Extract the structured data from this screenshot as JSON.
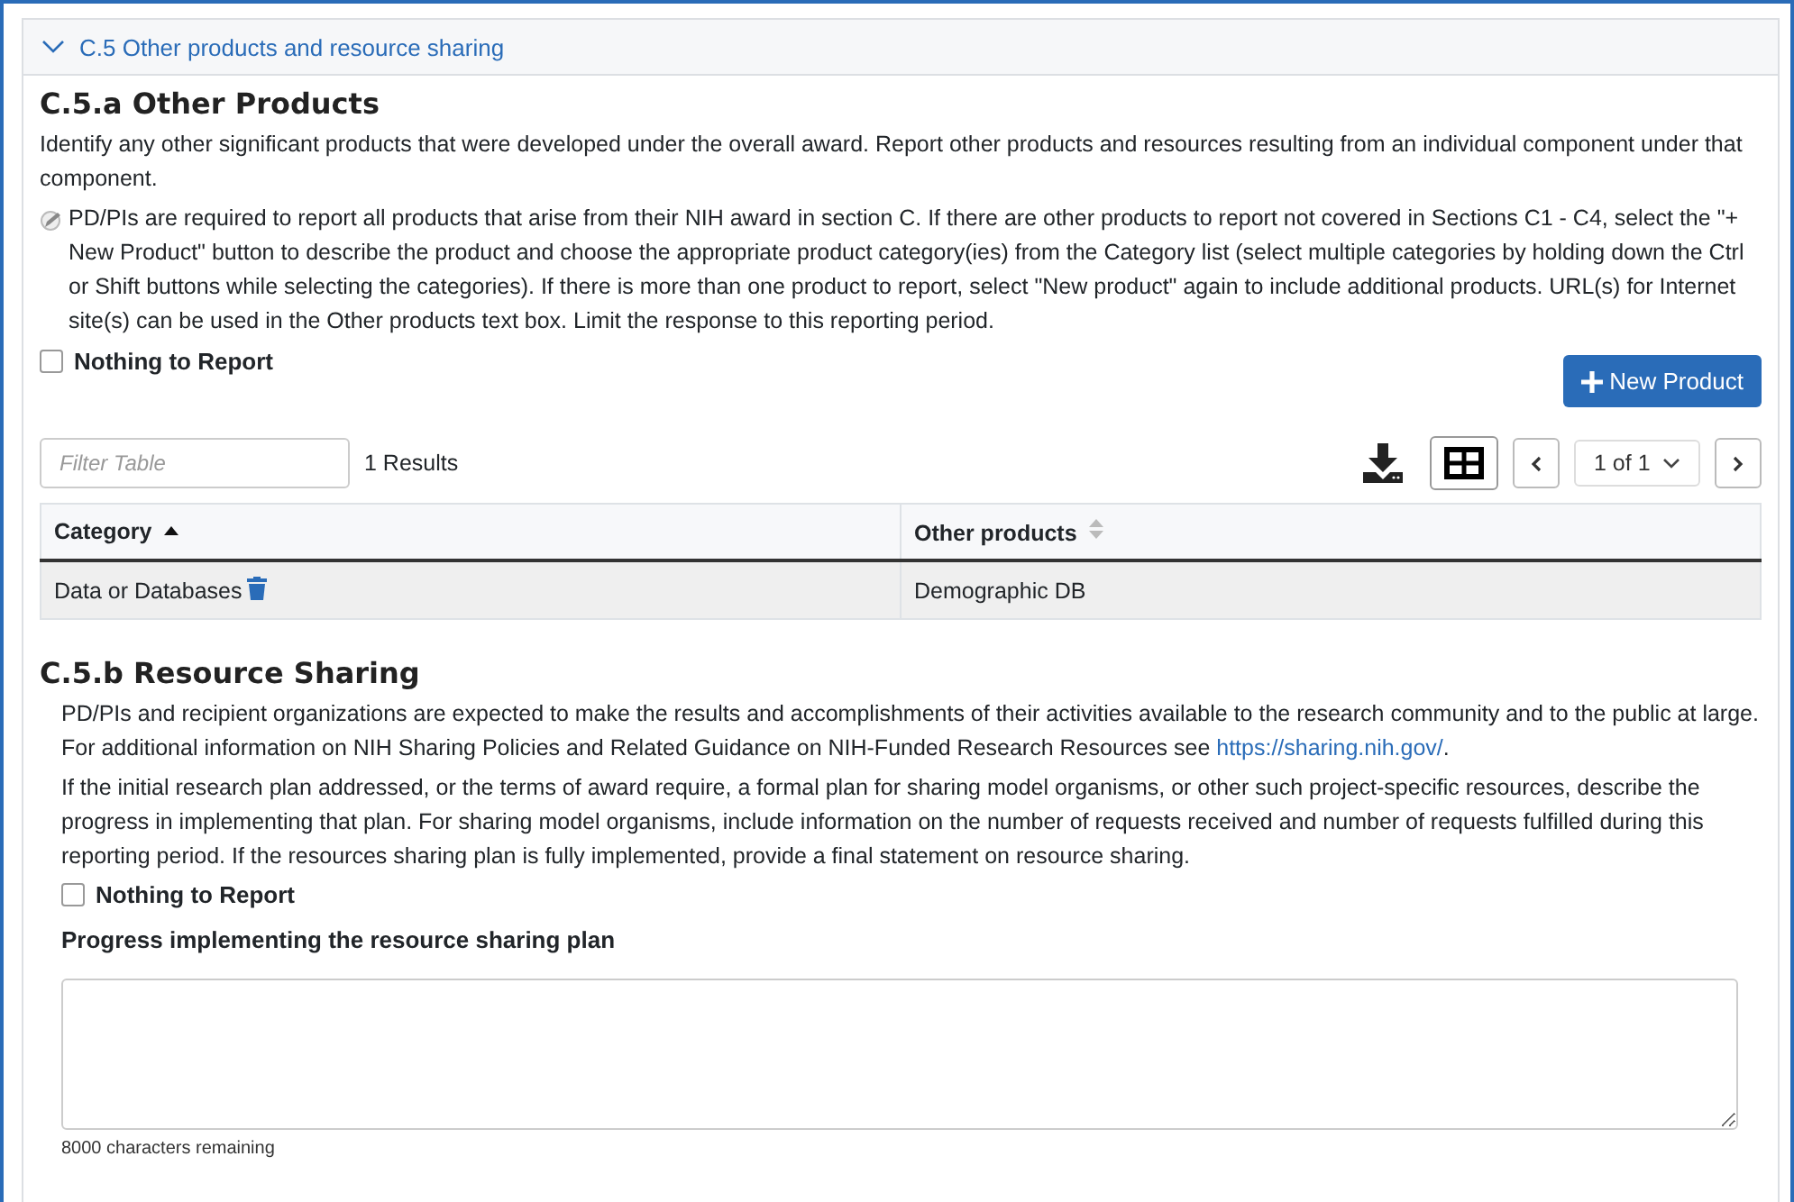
{
  "section": {
    "title": "C.5 Other products and resource sharing",
    "expanded": true
  },
  "other_products": {
    "heading": "C.5.a Other Products",
    "intro": "Identify any other significant products that were developed under the overall award. Report other products and resources resulting from an individual component under that component.",
    "note": "PD/PIs are required to report all products that arise from their NIH award in section C. If there are other products to report not covered in Sections C1 - C4, select the \"+ New Product\" button to describe the product and choose the appropriate product category(ies) from the Category list (select multiple categories by holding down the Ctrl or Shift buttons while selecting the categories). If there is more than one product to report, select \"New product\" again to include additional products. URL(s) for Internet site(s) can be used in the Other products text box. Limit the response to this reporting period.",
    "nothing_to_report": {
      "label": "Nothing to Report",
      "checked": false
    },
    "new_button": "New Product",
    "filter": {
      "placeholder": "Filter Table"
    },
    "results": "1 Results",
    "pager": {
      "page": "1 of 1"
    },
    "table": {
      "columns": [
        {
          "label": "Category",
          "sorted": true,
          "descending": false
        },
        {
          "label": "Other products",
          "sorted": false
        }
      ],
      "rows": [
        {
          "cells": [
            "Data or Databases",
            "Demographic DB"
          ]
        }
      ]
    }
  },
  "resource_sharing": {
    "heading": "C.5.b Resource Sharing",
    "paragraph_1": "PD/PIs and recipient organizations are expected to make the results and accomplishments of their activities available to the research community and to the public at large. For additional information on NIH Sharing Policies and Related Guidance on NIH-Funded Research Resources see",
    "link": "https://sharing.nih.gov/",
    "paragraph_1_end": ".",
    "paragraph_2": "If the initial research plan addressed, or the terms of award require, a formal plan for sharing model organisms, or other such project-specific resources, describe the progress in implementing that plan. For sharing model organisms, include information on the number of requests received and number of requests fulfilled during this reporting period. If the resources sharing plan is fully implemented, provide a final statement on resource sharing.",
    "nothing_to_report": {
      "label": "Nothing to Report",
      "checked": false
    },
    "field_label": "Progress implementing the resource sharing plan",
    "remaining": "8000 characters remaining"
  }
}
